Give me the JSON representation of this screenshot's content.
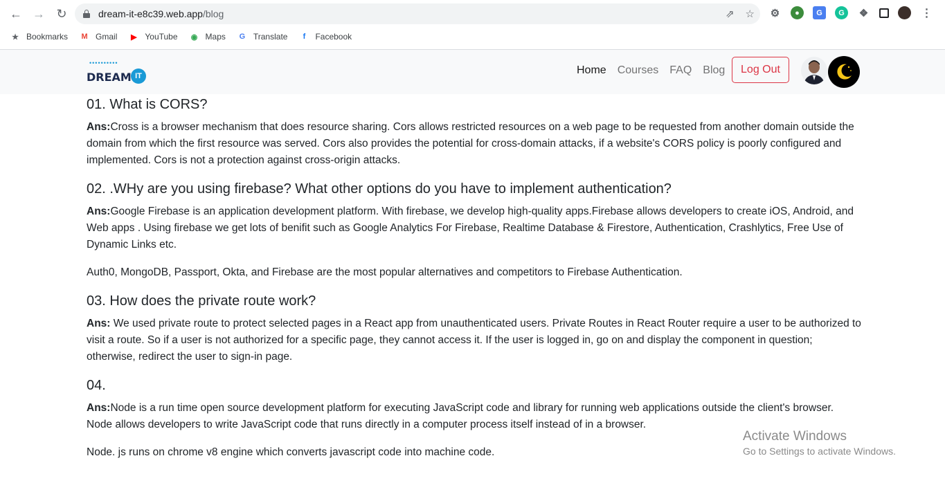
{
  "browser": {
    "url_host": "dream-it-e8c39.web.app",
    "url_path": "/blog",
    "bookmarks": [
      {
        "label": "Bookmarks",
        "icon": "star-icon"
      },
      {
        "label": "Gmail",
        "icon": "gmail-icon"
      },
      {
        "label": "YouTube",
        "icon": "youtube-icon"
      },
      {
        "label": "Maps",
        "icon": "maps-icon"
      },
      {
        "label": "Translate",
        "icon": "translate-icon"
      },
      {
        "label": "Facebook",
        "icon": "facebook-icon"
      }
    ]
  },
  "site_nav": {
    "logo_text": "DREAM",
    "logo_badge": "IT",
    "links": [
      "Home",
      "Courses",
      "FAQ",
      "Blog"
    ],
    "logout_label": "Log Out"
  },
  "blog": [
    {
      "question": "01. What is CORS?",
      "answers": [
        {
          "prefix": "Ans:",
          "text": "Cross is a browser mechanism that does resource sharing. Cors allows restricted resources on a web page to be requested from another domain outside the domain from which the first resource was served. Cors also provides the potential for cross-domain attacks, if a website's CORS policy is poorly configured and implemented. Cors is not a protection against cross-origin attacks."
        }
      ]
    },
    {
      "question": "02. .WHy are you using firebase? What other options do you have to implement authentication?",
      "answers": [
        {
          "prefix": "Ans:",
          "text": "Google Firebase is an application development platform. With firebase, we develop high-quality apps.Firebase allows developers to create iOS, Android, and Web apps . Using firebase we get lots of benifit such as Google Analytics For Firebase, Realtime Database & Firestore, Authentication, Crashlytics, Free Use of Dynamic Links etc."
        },
        {
          "prefix": "",
          "text": "Auth0, MongoDB, Passport, Okta, and Firebase are the most popular alternatives and competitors to Firebase Authentication."
        }
      ]
    },
    {
      "question": "03. How does the private route work?",
      "answers": [
        {
          "prefix": "Ans:",
          "text": " We used private route to protect selected pages in a React app from unauthenticated users. Private Routes in React Router require a user to be authorized to visit a route. So if a user is not authorized for a specific page, they cannot access it. If the user is logged in, go on and display the component in question; otherwise, redirect the user to sign-in page."
        }
      ]
    },
    {
      "question": "04.",
      "answers": [
        {
          "prefix": "Ans:",
          "text": "Node is a run time open source development platform for executing JavaScript code and library for running web applications outside the client's browser. Node allows developers to write JavaScript code that runs directly in a computer process itself instead of in a browser."
        },
        {
          "prefix": "",
          "text": "Node. js runs on chrome v8 engine which converts javascript code into machine code."
        }
      ]
    }
  ],
  "watermark": {
    "line1": "Activate Windows",
    "line2": "Go to Settings to activate Windows."
  },
  "colors": {
    "logout": "#dc3545",
    "brand_blue": "#1a9ad6"
  }
}
